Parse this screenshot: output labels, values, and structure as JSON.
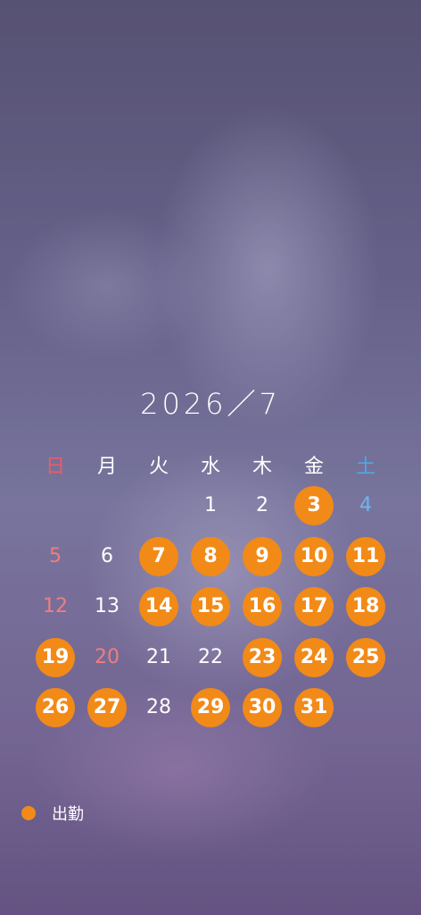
{
  "calendar": {
    "title": "2026／7",
    "weekdays": [
      {
        "label": "日",
        "type": "sun"
      },
      {
        "label": "月",
        "type": "normal"
      },
      {
        "label": "火",
        "type": "normal"
      },
      {
        "label": "水",
        "type": "normal"
      },
      {
        "label": "木",
        "type": "normal"
      },
      {
        "label": "金",
        "type": "normal"
      },
      {
        "label": "土",
        "type": "sat"
      }
    ],
    "weeks": [
      [
        null,
        null,
        null,
        {
          "day": "1",
          "type": "normal",
          "work": false
        },
        {
          "day": "2",
          "type": "normal",
          "work": false
        },
        {
          "day": "3",
          "type": "normal",
          "work": true
        },
        {
          "day": "4",
          "type": "sat",
          "work": false
        }
      ],
      [
        {
          "day": "5",
          "type": "sun",
          "work": false
        },
        {
          "day": "6",
          "type": "normal",
          "work": false
        },
        {
          "day": "7",
          "type": "normal",
          "work": true
        },
        {
          "day": "8",
          "type": "normal",
          "work": true
        },
        {
          "day": "9",
          "type": "normal",
          "work": true
        },
        {
          "day": "10",
          "type": "normal",
          "work": true
        },
        {
          "day": "11",
          "type": "sat",
          "work": true
        }
      ],
      [
        {
          "day": "12",
          "type": "sun",
          "work": false
        },
        {
          "day": "13",
          "type": "normal",
          "work": false
        },
        {
          "day": "14",
          "type": "normal",
          "work": true
        },
        {
          "day": "15",
          "type": "normal",
          "work": true
        },
        {
          "day": "16",
          "type": "normal",
          "work": true
        },
        {
          "day": "17",
          "type": "normal",
          "work": true
        },
        {
          "day": "18",
          "type": "sat",
          "work": true
        }
      ],
      [
        {
          "day": "19",
          "type": "sun",
          "work": true
        },
        {
          "day": "20",
          "type": "holiday",
          "work": false
        },
        {
          "day": "21",
          "type": "normal",
          "work": false
        },
        {
          "day": "22",
          "type": "normal",
          "work": false
        },
        {
          "day": "23",
          "type": "normal",
          "work": true
        },
        {
          "day": "24",
          "type": "normal",
          "work": true
        },
        {
          "day": "25",
          "type": "sat",
          "work": true
        }
      ],
      [
        {
          "day": "26",
          "type": "sun",
          "work": true
        },
        {
          "day": "27",
          "type": "normal",
          "work": true
        },
        {
          "day": "28",
          "type": "normal",
          "work": false
        },
        {
          "day": "29",
          "type": "normal",
          "work": true
        },
        {
          "day": "30",
          "type": "normal",
          "work": true
        },
        {
          "day": "31",
          "type": "normal",
          "work": true
        },
        null
      ]
    ]
  },
  "legend": {
    "label": "出勤",
    "color": "#f28a18"
  },
  "colors": {
    "work_circle": "#f28a18",
    "sunday": "#ef5a64",
    "saturday": "#4fa7e6",
    "holiday_date": "#f07d7f",
    "text": "#ffffff"
  }
}
